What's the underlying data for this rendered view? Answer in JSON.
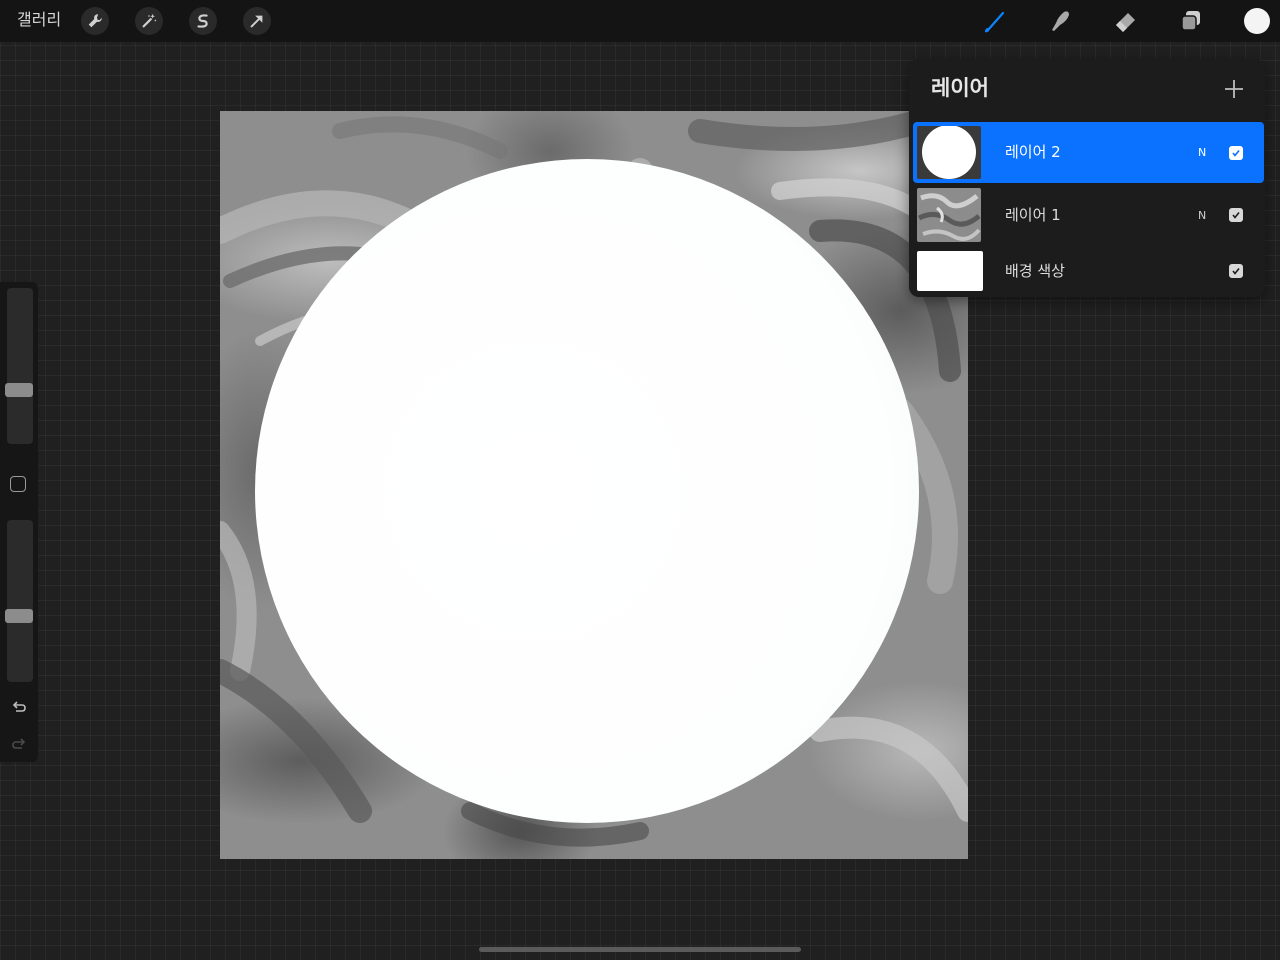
{
  "toolbar": {
    "gallery_label": "갤러리",
    "left_tools": [
      {
        "name": "actions",
        "icon": "wrench-icon"
      },
      {
        "name": "adjustments",
        "icon": "magic-wand-icon"
      },
      {
        "name": "selection",
        "icon": "selection-s-icon"
      },
      {
        "name": "transform",
        "icon": "arrow-cursor-icon"
      }
    ],
    "right_tools": [
      {
        "name": "brush",
        "icon": "brush-icon",
        "active": true
      },
      {
        "name": "smudge",
        "icon": "smudge-icon",
        "active": false
      },
      {
        "name": "eraser",
        "icon": "eraser-icon",
        "active": false
      },
      {
        "name": "layers",
        "icon": "layers-icon",
        "active": true
      }
    ],
    "active_color": "#f4f4f4",
    "accent_color": "#0a84ff"
  },
  "layers_panel": {
    "title": "레이어",
    "add_icon": "plus-icon",
    "layers": [
      {
        "name": "레이어 2",
        "blend_mode": "N",
        "visible": true,
        "selected": true
      },
      {
        "name": "레이어 1",
        "blend_mode": "N",
        "visible": true,
        "selected": false
      },
      {
        "name": "배경 색상",
        "blend_mode": "",
        "visible": true,
        "selected": false
      }
    ]
  },
  "sidebar": {
    "brush_size_level": 0.33,
    "opacity_level": 0.4,
    "modify_icon": "square-icon",
    "undo_icon": "undo-icon",
    "redo_icon": "redo-icon"
  }
}
